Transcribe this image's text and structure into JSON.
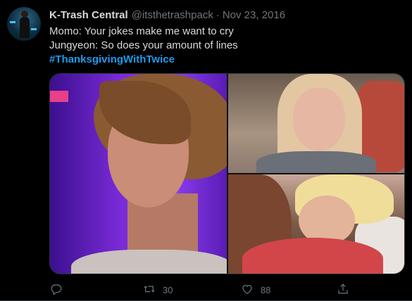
{
  "tweet": {
    "author": {
      "display_name": "K-Trash Central",
      "handle": "@itsthetrashpack",
      "avatar": "avatar"
    },
    "separator": "·",
    "timestamp": "Nov 23, 2016",
    "lines": [
      "Momo: Your jokes make me want to cry",
      "Jungyeon: So does your amount of lines"
    ],
    "hashtag": "#ThanksgivingWithTwice",
    "media": {
      "count": 3,
      "icons": [
        "photo-left",
        "photo-top-right",
        "photo-bottom-right"
      ]
    },
    "actions": {
      "reply": {
        "icon": "reply-icon",
        "count": ""
      },
      "retweet": {
        "icon": "retweet-icon",
        "count": "30"
      },
      "like": {
        "icon": "heart-icon",
        "count": "88"
      },
      "share": {
        "icon": "share-icon",
        "count": ""
      }
    }
  },
  "colors": {
    "background": "#000000",
    "text": "#d9d9d9",
    "muted": "#6e767d",
    "accent": "#1d9bf0",
    "border": "#2f3336"
  }
}
